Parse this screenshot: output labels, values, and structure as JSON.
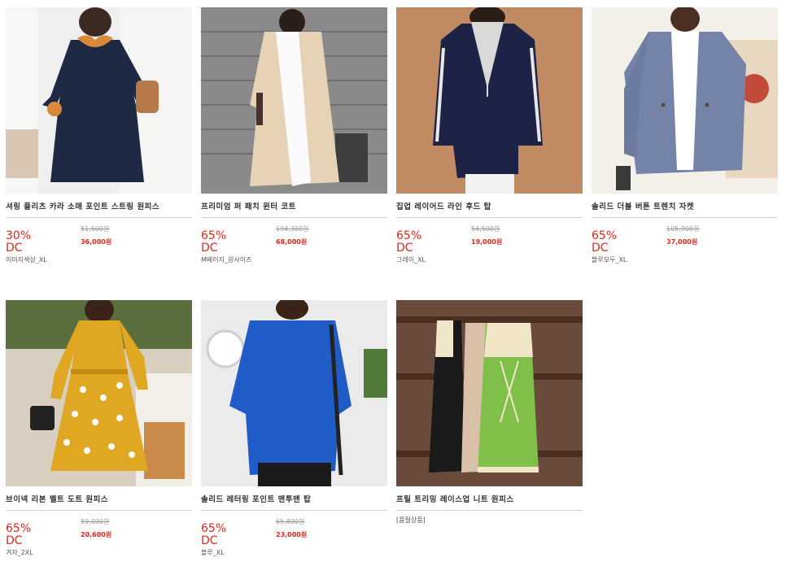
{
  "products": [
    {
      "title": "셔링 플리츠 카라 소매 포인트 스트링 원피스",
      "discount": "30%",
      "dc": "DC",
      "original": "51,500원",
      "sale": "36,000원",
      "option": "이미지색상_XL",
      "colors": {
        "bg": "#eeeeee",
        "main": "#1e2a44",
        "accent": "#d88a3a"
      }
    },
    {
      "title": "프리미엄 퍼 패치 윈터 코트",
      "discount": "65%",
      "dc": "DC",
      "original": "194,300원",
      "sale": "68,000원",
      "option": "M베이지_원사이즈",
      "colors": {
        "bg": "#7b7b7b",
        "main": "#e6d3b6",
        "accent": "#fafafa"
      }
    },
    {
      "title": "집업 레이어드 라인 후드 탑",
      "discount": "65%",
      "dc": "DC",
      "original": "54,500원",
      "sale": "19,000원",
      "option": "그레이_XL",
      "colors": {
        "bg": "#c08a62",
        "main": "#1c2347",
        "accent": "#d9d9d9"
      }
    },
    {
      "title": "솔리드 더블 버튼 트렌치 자켓",
      "discount": "65%",
      "dc": "DC",
      "original": "105,900원",
      "sale": "37,000원",
      "option": "블루모두_XL",
      "colors": {
        "bg": "#f1ebe3",
        "main": "#7583a8",
        "accent": "#ffffff"
      }
    },
    {
      "title": "브이넥 리본 벨트 도트 원피스",
      "discount": "65%",
      "dc": "DC",
      "original": "59,000원",
      "sale": "20,600원",
      "option": "겨자_2XL",
      "colors": {
        "bg": "#d8cfc0",
        "main": "#e0a822",
        "accent": "#ffffff"
      }
    },
    {
      "title": "솔리드 레터링 포인트 맨투맨 탑",
      "discount": "65%",
      "dc": "DC",
      "original": "65,800원",
      "sale": "23,000원",
      "option": "블루_XL",
      "colors": {
        "bg": "#e9e9e9",
        "main": "#1f5cc7",
        "accent": "#ffffff"
      }
    },
    {
      "title": "프릴 트리밍 레이스업 니트 원피스",
      "soldout": "[품절상품]",
      "colors": {
        "bg": "#6a4a3a",
        "main": "#7fbf4a",
        "accent": "#f2e6c8"
      }
    }
  ]
}
